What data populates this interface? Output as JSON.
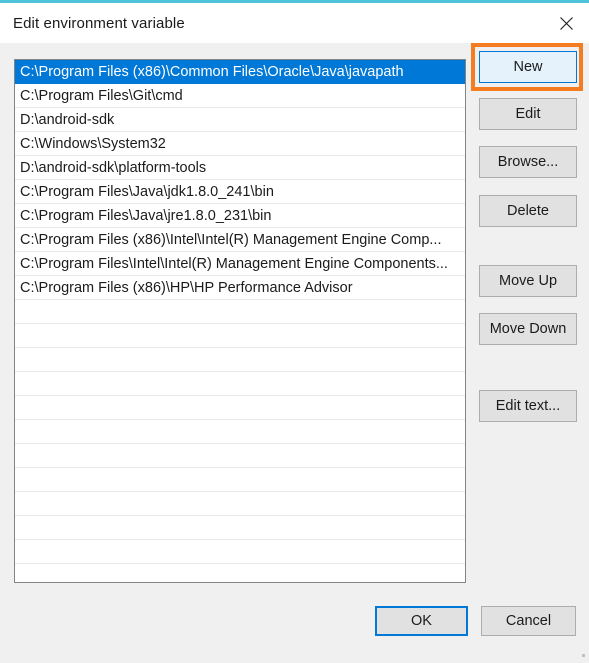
{
  "window": {
    "title": "Edit environment variable",
    "accent_color": "#4ec3d9",
    "close_icon": "close-icon"
  },
  "listbox": {
    "selected_index": 0,
    "selection_color": "#0078d7",
    "entries": [
      "C:\\Program Files (x86)\\Common Files\\Oracle\\Java\\javapath",
      "C:\\Program Files\\Git\\cmd",
      "D:\\android-sdk",
      "C:\\Windows\\System32",
      "D:\\android-sdk\\platform-tools",
      "C:\\Program Files\\Java\\jdk1.8.0_241\\bin",
      "C:\\Program Files\\Java\\jre1.8.0_231\\bin",
      "C:\\Program Files (x86)\\Intel\\Intel(R) Management Engine Comp...",
      "C:\\Program Files\\Intel\\Intel(R) Management Engine Components...",
      "C:\\Program Files (x86)\\HP\\HP Performance Advisor"
    ],
    "empty_row_count": 11
  },
  "side_buttons": {
    "new": "New",
    "edit": "Edit",
    "browse": "Browse...",
    "delete": "Delete",
    "move_up": "Move Up",
    "move_down": "Move Down",
    "edit_text": "Edit text..."
  },
  "bottom_buttons": {
    "ok": "OK",
    "cancel": "Cancel"
  },
  "annotation": {
    "target": "New",
    "color": "#f57c20"
  }
}
